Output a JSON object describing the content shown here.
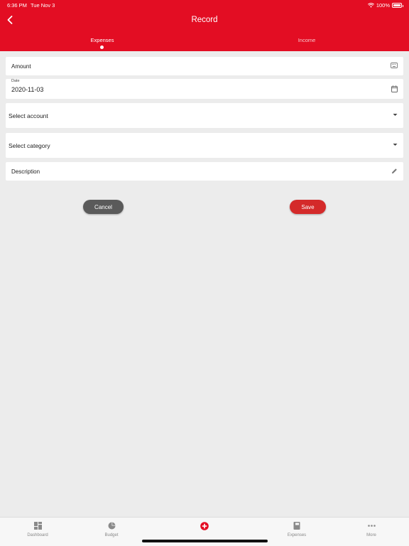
{
  "status_bar": {
    "time": "6:36 PM",
    "date": "Tue Nov 3",
    "battery": "100%"
  },
  "header": {
    "title": "Record"
  },
  "tabs": [
    {
      "label": "Expenses",
      "active": true
    },
    {
      "label": "Income",
      "active": false
    }
  ],
  "form": {
    "amount_label": "Amount",
    "date_label": "Date",
    "date_value": "2020-11-03",
    "account_label": "Select account",
    "category_label": "Select category",
    "description_label": "Description"
  },
  "buttons": {
    "cancel": "Cancel",
    "save": "Save"
  },
  "bottom_nav": [
    {
      "label": "Dashboard",
      "icon": "dashboard-icon"
    },
    {
      "label": "",
      "icon": "add-circle-icon"
    },
    {
      "label": "Budget",
      "icon": "pie-chart-icon"
    },
    {
      "label": "Expenses",
      "icon": "book-icon"
    },
    {
      "label": "More",
      "icon": "more-icon"
    }
  ],
  "colors": {
    "brand": "#e30d23",
    "save": "#d42a2a",
    "cancel": "#5a5a5a",
    "background": "#ececec"
  }
}
